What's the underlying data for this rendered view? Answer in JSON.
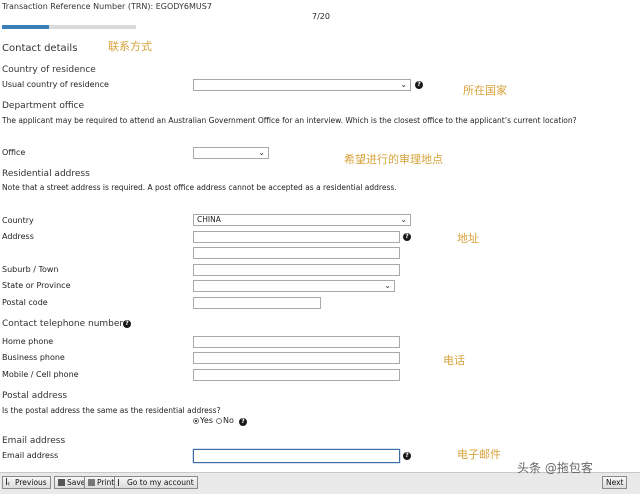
{
  "header": {
    "trn_label": "Transaction Reference Number (TRN): EGODY6MUS7",
    "page_indicator": "7/20",
    "progress": 0.35
  },
  "annotations": {
    "contact": "联系方式",
    "country": "所在国家",
    "office": "希望进行的审理地点",
    "address": "地址",
    "phone": "电话",
    "email": "电子邮件"
  },
  "contact": {
    "title": "Contact details"
  },
  "residence": {
    "section": "Country of residence",
    "usual_label": "Usual country of residence",
    "usual_value": ""
  },
  "office": {
    "section": "Department office",
    "note": "The applicant may be required to attend an Australian Government Office for an interview. Which is the closest office to the applicant’s current location?",
    "label": "Office",
    "value": ""
  },
  "residential": {
    "section": "Residential address",
    "note": "Note that a street address is required. A post office address cannot be accepted as a residential address.",
    "country_label": "Country",
    "country_value": "CHINA",
    "address_label": "Address",
    "suburb_label": "Suburb / Town",
    "state_label": "State or Province",
    "state_value": "",
    "postal_label": "Postal code"
  },
  "phones": {
    "section": "Contact telephone numbers",
    "home_label": "Home phone",
    "business_label": "Business phone",
    "mobile_label": "Mobile / Cell phone"
  },
  "postal": {
    "section": "Postal address",
    "question": "Is the postal address the same as the residential address?",
    "yes": "Yes",
    "no": "No",
    "selected": "Yes"
  },
  "email": {
    "section": "Email address",
    "label": "Email address",
    "value": ""
  },
  "footer": {
    "previous": "Previous",
    "save": "Save",
    "print": "Print",
    "account": "Go to my account",
    "next": "Next"
  },
  "watermark": "头条 @拖包客",
  "icons": {
    "help": "help-icon",
    "dropdown": "chevron-down-icon"
  },
  "colors": {
    "progress": "#3b7fb8",
    "annotation": "#d7a23a"
  }
}
